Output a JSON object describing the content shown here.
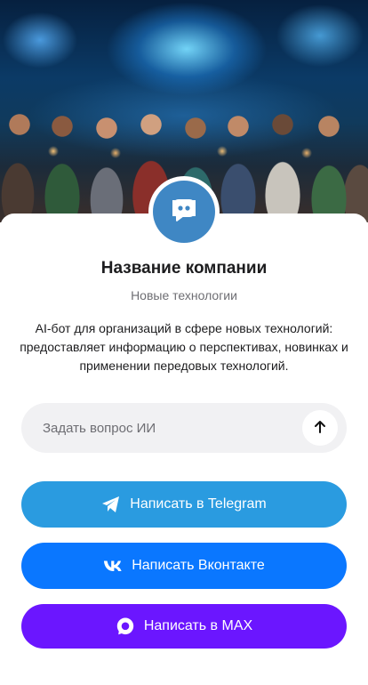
{
  "company": {
    "name": "Название компании",
    "subtitle": "Новые технологии",
    "description": "AI-бот для организаций в сфере новых технологий: предоставляет информацию о перспективах, новинках и применении передовых технологий."
  },
  "ask": {
    "placeholder": "Задать вопрос ИИ"
  },
  "buttons": {
    "telegram": "Написать в Telegram",
    "vk": "Написать Вконтакте",
    "max": "Написать в MAX"
  },
  "icons": {
    "avatar": "chat-bubble-icon",
    "send": "arrow-up-icon",
    "telegram": "telegram-icon",
    "vk": "vk-icon",
    "max": "max-icon"
  },
  "colors": {
    "avatar": "#3f87c4",
    "telegram": "#2a9be0",
    "vk": "#0a77ff",
    "max": "#6b16ff"
  }
}
